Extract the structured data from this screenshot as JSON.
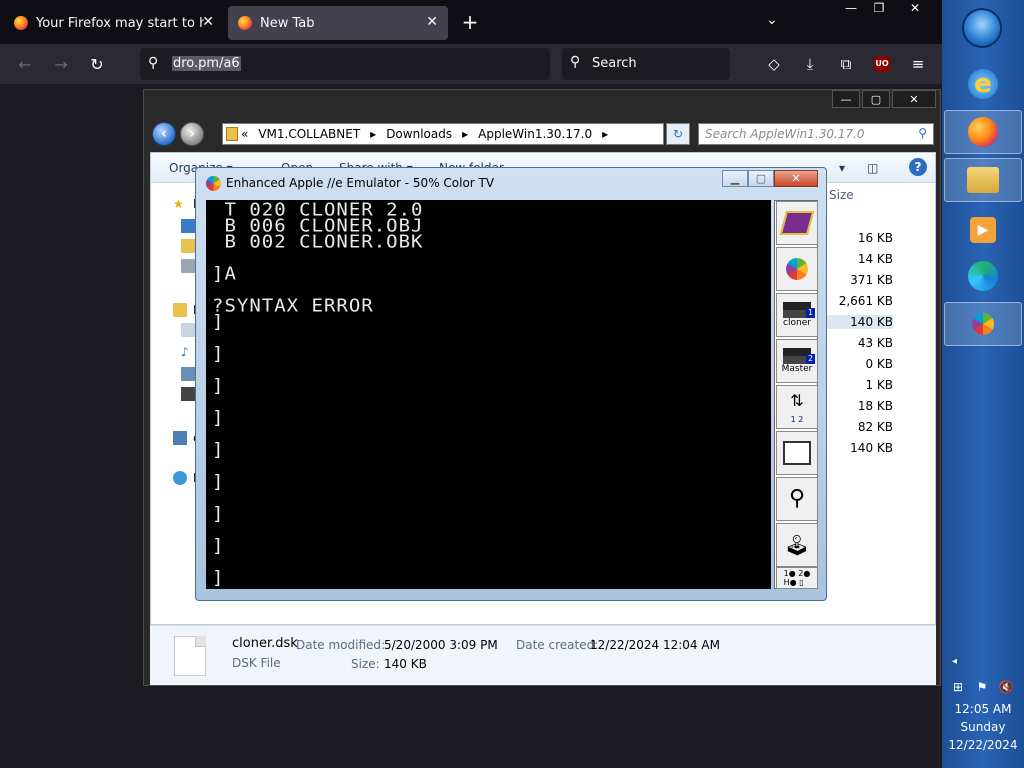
{
  "firefox": {
    "tabs": [
      {
        "title": "Your Firefox may start to have p",
        "close": "✕"
      },
      {
        "title": "New Tab",
        "close": "✕"
      }
    ],
    "new_tab": "+",
    "tab_list": "⌄",
    "window_controls": {
      "minimize": "—",
      "restore": "❐",
      "close": "✕"
    },
    "nav": {
      "back": "←",
      "forward": "→",
      "reload": "↻"
    },
    "url": "dro.pm/a6",
    "search_placeholder": "Search",
    "toolbar_icons": {
      "pocket": "◇",
      "downloads": "⤓",
      "extensions": "⧉",
      "ublock": "UO",
      "menu": "≡"
    }
  },
  "explorer": {
    "controls": {
      "minimize": "—",
      "restore": "▢",
      "close": "✕"
    },
    "breadcrumb": [
      "«",
      "VM1.COLLABNET",
      "▸",
      "Downloads",
      "▸",
      "AppleWin1.30.17.0",
      "▸"
    ],
    "search_placeholder": "Search AppleWin1.30.17.0",
    "toolbar": {
      "organize": "Organize ▾",
      "open": "Open",
      "share": "Share with ▾",
      "new_folder": "New folder",
      "help": "?"
    },
    "size_header": "Size",
    "sizes": [
      "16 KB",
      "14 KB",
      "371 KB",
      "2,661 KB",
      "140 KB",
      "43 KB",
      "0 KB",
      "1 KB",
      "18 KB",
      "82 KB",
      "140 KB"
    ],
    "nav_letters": [
      "F",
      "L",
      "c",
      "N"
    ],
    "details": {
      "filename": "cloner.dsk",
      "type": "DSK File",
      "modified_label": "Date modified:",
      "modified": "5/20/2000 3:09 PM",
      "created_label": "Date created:",
      "created": "12/22/2024 12:04 AM",
      "size_label": "Size:",
      "size": "140 KB"
    }
  },
  "applewin": {
    "title": "Enhanced Apple //e Emulator -  50% Color TV",
    "controls": {
      "minimize": "▁",
      "maximize": "▢",
      "close": "✕"
    },
    "screen_lines": [
      " T 020 CLONER 2.0",
      " B 006 CLONER.OBJ",
      " B 002 CLONER.OBK",
      "",
      "]A",
      "",
      "?SYNTAX ERROR",
      "]",
      "",
      "]",
      "",
      "]",
      "",
      "]",
      "",
      "]",
      "",
      "]",
      "",
      "]",
      "",
      "]",
      "",
      "]",
      "",
      "]"
    ],
    "side_buttons": {
      "drive1_label": "cloner",
      "drive2_label": "Master",
      "drive1_num": "1",
      "drive2_num": "2",
      "swap_nums": [
        "1",
        "2"
      ],
      "status_text": "1● 2●\nH● ▯"
    }
  },
  "taskbar": {
    "clock_time": "12:05 AM",
    "clock_day": "Sunday",
    "clock_date": "12/22/2024",
    "tray_expand": "◂"
  }
}
